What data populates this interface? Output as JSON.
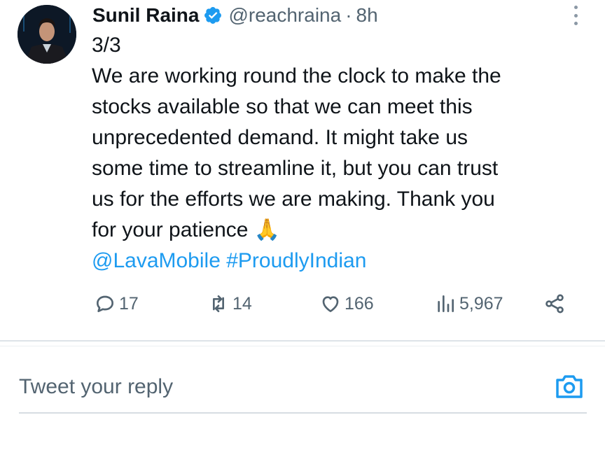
{
  "tweet": {
    "author_name": "Sunil Raina",
    "author_handle": "@reachraina",
    "separator": "·",
    "timestamp": "8h",
    "body_lines": [
      "3/3",
      "We are working round the clock to make the",
      "stocks available so that we can meet this",
      "unprecedented demand. It might take us",
      "some time to streamline it, but you can trust",
      "us for the efforts we are making. Thank you",
      "for your patience"
    ],
    "emoji": "🙏",
    "mention": "@LavaMobile",
    "hashtag": "#ProudlyIndian"
  },
  "actions": {
    "replies": "17",
    "retweets": "14",
    "likes": "166",
    "views": "5,967"
  },
  "reply": {
    "placeholder": "Tweet your reply"
  },
  "colors": {
    "link": "#1d9bf0",
    "verified": "#1d9bf0",
    "muted": "#536471",
    "text": "#0f1419"
  }
}
